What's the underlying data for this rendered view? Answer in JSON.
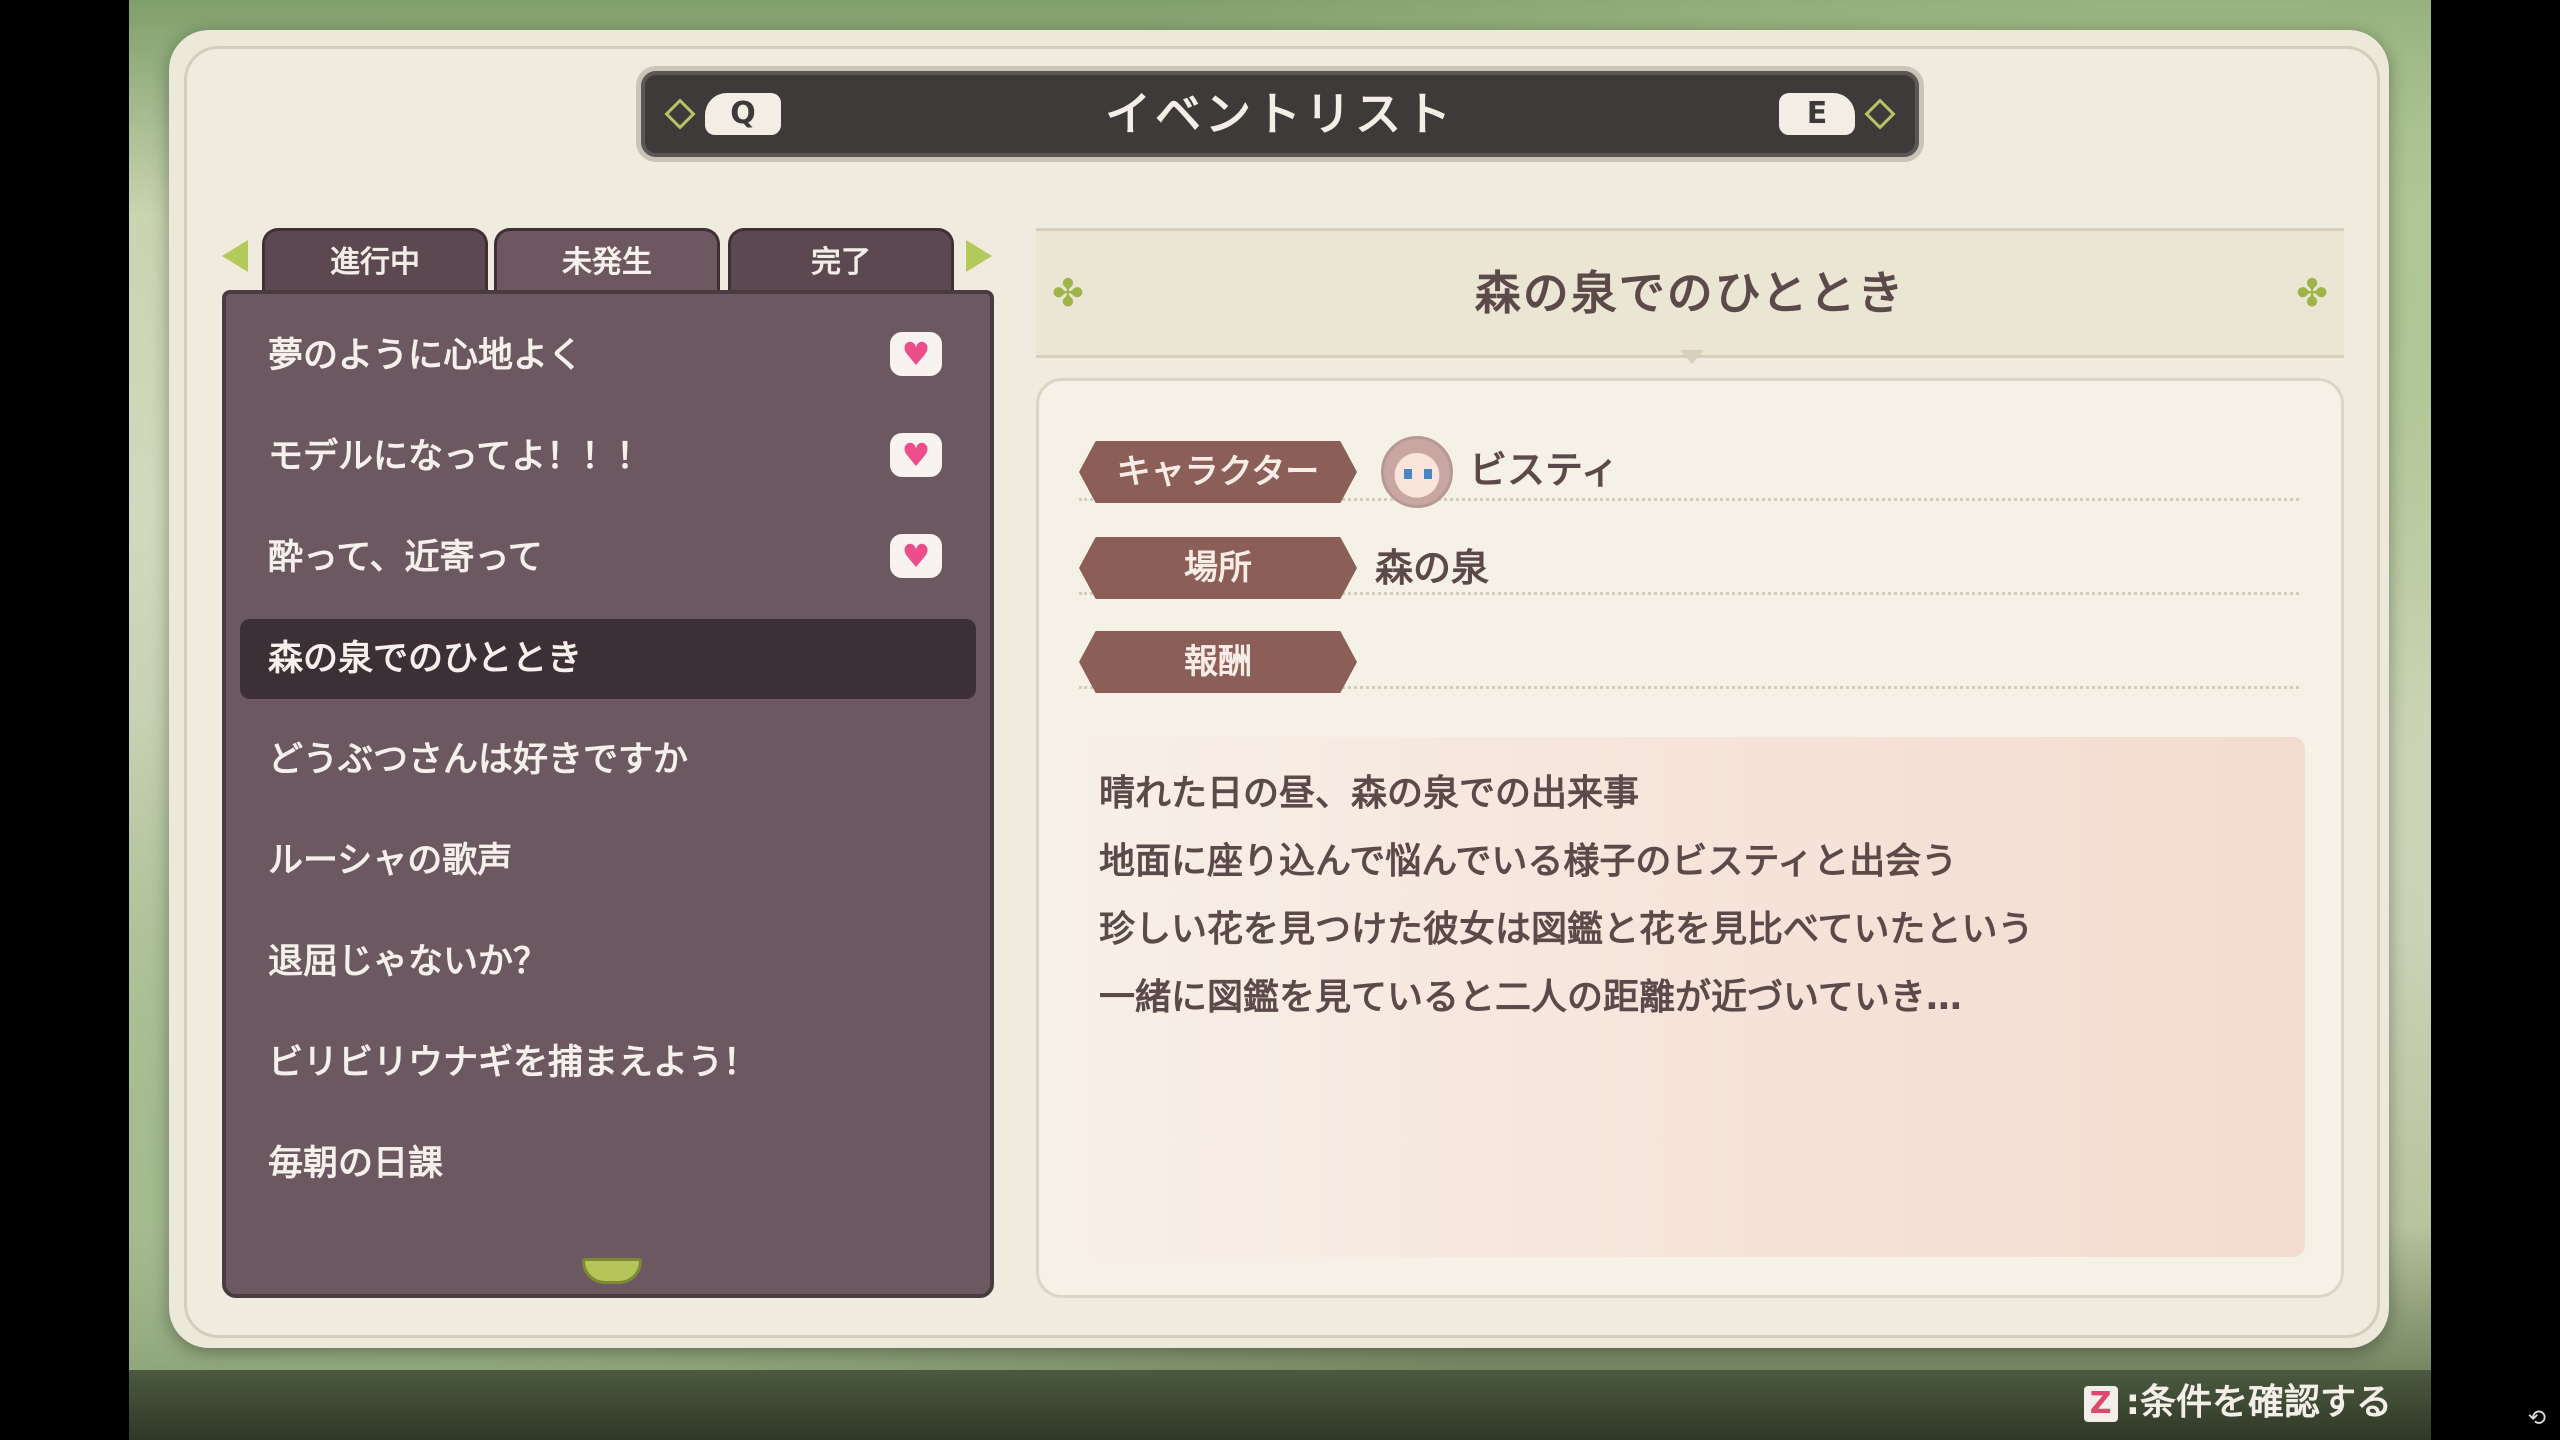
{
  "header": {
    "title": "イベントリスト",
    "key_left": "Q",
    "key_right": "E"
  },
  "tabs": [
    {
      "label": "進行中",
      "active": false
    },
    {
      "label": "未発生",
      "active": true
    },
    {
      "label": "完了",
      "active": false
    }
  ],
  "events": [
    {
      "title": "夢のように心地よく",
      "heart": true
    },
    {
      "title": "モデルになってよ！！！",
      "heart": true
    },
    {
      "title": "酔って、近寄って",
      "heart": true
    },
    {
      "title": "森の泉でのひととき",
      "heart": false,
      "selected": true
    },
    {
      "title": "どうぶつさんは好きですか",
      "heart": false
    },
    {
      "title": "ルーシャの歌声",
      "heart": false
    },
    {
      "title": "退屈じゃないか？",
      "heart": false
    },
    {
      "title": "ビリビリウナギを捕まえよう！",
      "heart": false
    },
    {
      "title": "毎朝の日課",
      "heart": false
    }
  ],
  "detail": {
    "title": "森の泉でのひととき",
    "fields": {
      "character_label": "キャラクター",
      "character_value": "ビスティ",
      "location_label": "場所",
      "location_value": "森の泉",
      "reward_label": "報酬",
      "reward_value": ""
    },
    "description": [
      "晴れた日の昼、森の泉での出来事",
      "地面に座り込んで悩んでいる様子のビスティと出会う",
      "珍しい花を見つけた彼女は図鑑と花を見比べていたという",
      "一緒に図鑑を見ていると二人の距離が近づいていき…"
    ]
  },
  "footer": {
    "hint_key": "Z",
    "hint_text": ":条件を確認する"
  },
  "colors": {
    "list_bg": "#6b5860",
    "label_bg": "#8b5e57",
    "accent_green": "#b3c95c",
    "heart": "#ee4d8b"
  }
}
